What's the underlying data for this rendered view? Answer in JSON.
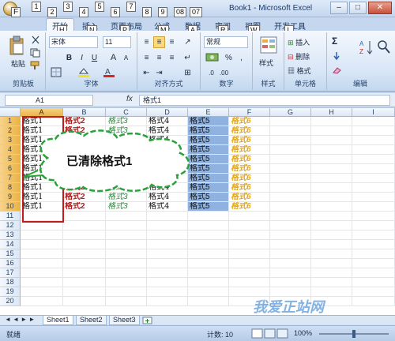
{
  "window": {
    "title": "Book1 - Microsoft Excel",
    "min_label": "–",
    "max_label": "□",
    "close_label": "✕"
  },
  "keytips": {
    "office": "F",
    "qat": [
      "1",
      "2",
      "3",
      "4",
      "5",
      "6",
      "7",
      "8",
      "9",
      "08",
      "07"
    ],
    "tabs": [
      "H",
      "N",
      "P",
      "M",
      "A",
      "R",
      "W",
      "L"
    ]
  },
  "tabs": [
    "开始",
    "插入",
    "页面布局",
    "公式",
    "数据",
    "审阅",
    "视图",
    "开发工具"
  ],
  "ribbon": {
    "clipboard": {
      "paste": "粘贴",
      "label": "剪贴板"
    },
    "font": {
      "name": "宋体",
      "size": "11",
      "bold": "B",
      "italic": "I",
      "underline": "U",
      "grow": "A",
      "shrink": "A",
      "label": "字体"
    },
    "alignment": {
      "label": "对齐方式"
    },
    "number": {
      "format": "常规",
      "percent": "%",
      "comma": ",",
      "label": "数字"
    },
    "styles": {
      "label": "样式"
    },
    "cells": {
      "insert": "插入",
      "delete": "删除",
      "format": "格式",
      "label": "单元格"
    },
    "editing": {
      "sum": "Σ",
      "label": "编辑"
    }
  },
  "formula_bar": {
    "name_box": "A1",
    "fx": "fx",
    "content": "格式1"
  },
  "sheet": {
    "columns": [
      "A",
      "B",
      "C",
      "D",
      "E",
      "F",
      "G",
      "H",
      "I"
    ],
    "rows": [
      "1",
      "2",
      "3",
      "4",
      "5",
      "6",
      "7",
      "8",
      "9",
      "10",
      "11",
      "12",
      "13",
      "14",
      "15",
      "16",
      "17",
      "18",
      "19",
      "20"
    ],
    "values": [
      "格式1",
      "格式2",
      "格式3",
      "格式4",
      "格式5",
      "格式6"
    ],
    "filled_rows": 10
  },
  "callout": {
    "text": "已清除格式1"
  },
  "sheet_tabs": [
    "Sheet1",
    "Sheet2",
    "Sheet3"
  ],
  "status": {
    "mode": "就绪",
    "count": "计数: 10",
    "zoom": "100%"
  },
  "watermark": {
    "text": "我爱正站网"
  }
}
